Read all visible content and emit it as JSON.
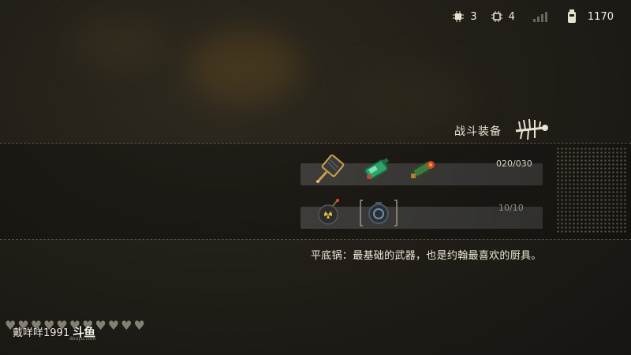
{
  "hud": {
    "chips_a": "3",
    "chips_b": "4",
    "money": "1170",
    "icons": [
      "chip-icon",
      "chip-icon",
      "signal-icon",
      "gas-tank-icon"
    ]
  },
  "section_title": "战斗装备",
  "weapons": {
    "count": "020/030",
    "items": [
      "frying-pan-icon",
      "green-blaster-icon",
      "flamethrower-icon"
    ]
  },
  "bombs": {
    "count": "10/10",
    "items": [
      "bomb-icon",
      "locked-slot-icon"
    ]
  },
  "description": "平底锅：最基础的武器，也是约翰最喜欢的厨具。",
  "watermark": {
    "user": "戴咩咩1991",
    "logo": "斗鱼",
    "sub": "douyu.com"
  },
  "colors": {
    "background": "#221f18",
    "text": "#e8e2d0",
    "slot_bar": "#5a5a5a"
  }
}
